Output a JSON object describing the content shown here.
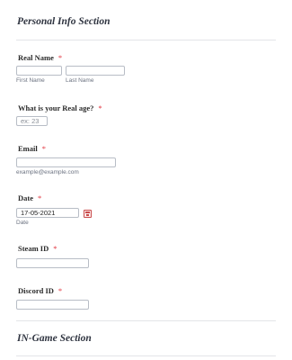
{
  "sections": {
    "personal": "Personal Info Section",
    "ingame": "IN-Game Section"
  },
  "required_mark": "*",
  "real_name": {
    "label": "Real Name",
    "first_sublabel": "First Name",
    "last_sublabel": "Last Name",
    "first_value": "",
    "last_value": ""
  },
  "age": {
    "label": "What is your Real age?",
    "placeholder": "ex: 23"
  },
  "email": {
    "label": "Email",
    "sublabel": "example@example.com"
  },
  "date": {
    "label": "Date",
    "value": "17-05-2021",
    "sublabel": "Date",
    "icon": "calendar-icon"
  },
  "steam": {
    "label": "Steam ID"
  },
  "discord": {
    "label": "Discord ID"
  }
}
